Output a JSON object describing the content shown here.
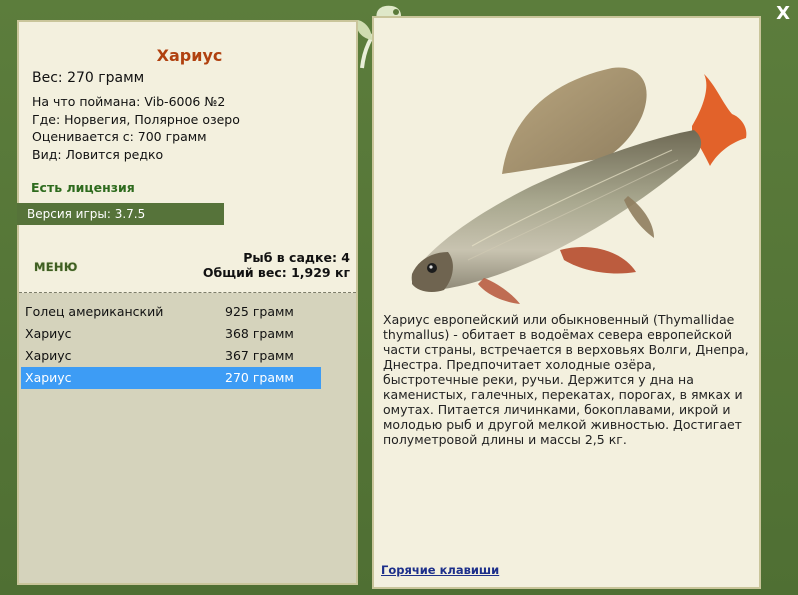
{
  "window": {
    "close_label": "X"
  },
  "fish": {
    "name": "Хариус",
    "weight": "Вес: 270 грамм",
    "lure": "На что поймана: Vib-6006 №2",
    "location": "Где: Норвегия, Полярное озеро",
    "value": "Оценивается с: 700 грамм",
    "rarity": "Вид: Ловится редко"
  },
  "license": "Есть лицензия",
  "version": "Версия игры: 3.7.5",
  "menu_label": "МЕНЮ",
  "stats": {
    "count": "Рыб в садке: 4",
    "total": "Общий вес: 1,929 кг"
  },
  "catch_list": [
    {
      "name": "Голец американский",
      "weight": "925 грамм"
    },
    {
      "name": "Хариус",
      "weight": "368 грамм"
    },
    {
      "name": "Хариус",
      "weight": "367 грамм"
    },
    {
      "name": "Хариус",
      "weight": "270 грамм",
      "selected": true
    }
  ],
  "description": "Хариус европейский или обыкновенный (Thymallidae thymallus) - обитает в водоёмах севера европейской части страны, встречается в верховьях Волги, Днепра, Днестра. Предпочитает холодные озёра, быстротечные реки, ручьи. Держится у дна на каменистых, галечных, перекатах, порогах, в ямках и омутах. Питается личинками, бокоплавами, икрой и молодью рыб и другой мелкой живностью. Достигает полуметровой длины и массы 2,5 кг.",
  "hotkeys_label": "Горячие клавиши",
  "colors": {
    "frame": "#5a7a3a",
    "panel": "#f3f0de",
    "title": "#b0410f",
    "license": "#2e6b1e",
    "selected_row": "#3d9cf5"
  },
  "icons": {
    "close": "close-icon",
    "logo": "leaf-logo-icon",
    "fish": "grayling-fish-image"
  }
}
